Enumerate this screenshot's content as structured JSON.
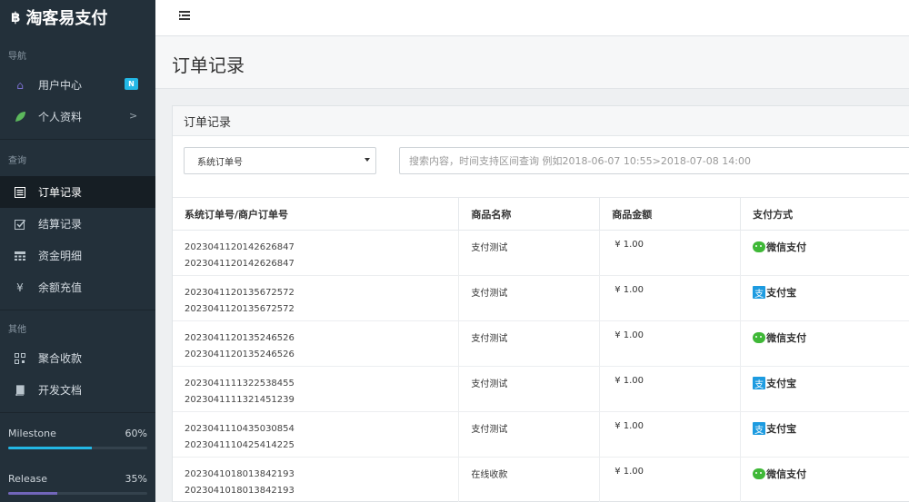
{
  "brand": {
    "icon": "฿",
    "title": "淘客易支付"
  },
  "sidebar": {
    "nav_title": "导航",
    "nav_items": [
      {
        "label": "用户中心",
        "icon": "home-icon",
        "badge": "N"
      },
      {
        "label": "个人资料",
        "icon": "leaf-icon",
        "chevron": ">"
      }
    ],
    "query_title": "查询",
    "query_items": [
      {
        "label": "订单记录",
        "icon": "list-icon",
        "active": true
      },
      {
        "label": "结算记录",
        "icon": "check-square-icon"
      },
      {
        "label": "资金明细",
        "icon": "calculator-icon"
      },
      {
        "label": "余额充值",
        "icon": "yen-icon"
      }
    ],
    "other_title": "其他",
    "other_items": [
      {
        "label": "聚合收款",
        "icon": "qrcode-icon"
      },
      {
        "label": "开发文档",
        "icon": "book-icon"
      }
    ],
    "progress": [
      {
        "label": "Milestone",
        "percent_text": "60%",
        "value": 0.6,
        "color": "#23b7e5"
      },
      {
        "label": "Release",
        "percent_text": "35%",
        "value": 0.35,
        "color": "#7266ba"
      }
    ]
  },
  "header": {
    "menu_icon": "menu-toggle-icon"
  },
  "page": {
    "title": "订单记录"
  },
  "panel": {
    "title": "订单记录",
    "select_value": "系统订单号",
    "search_placeholder": "搜索内容，时间支持区间查询 例如2018-06-07 10:55>2018-07-08 14:00"
  },
  "table": {
    "headers": [
      "系统订单号/商户订单号",
      "商品名称",
      "商品金额",
      "支付方式"
    ],
    "rows": [
      {
        "sys_no": "2023041120142626847",
        "mch_no": "2023041120142626847",
        "name": "支付测试",
        "amount": "¥ 1.00",
        "pay": "微信支付",
        "pay_type": "wechat"
      },
      {
        "sys_no": "2023041120135672572",
        "mch_no": "2023041120135672572",
        "name": "支付测试",
        "amount": "¥ 1.00",
        "pay": "支付宝",
        "pay_type": "alipay"
      },
      {
        "sys_no": "2023041120135246526",
        "mch_no": "2023041120135246526",
        "name": "支付测试",
        "amount": "¥ 1.00",
        "pay": "微信支付",
        "pay_type": "wechat"
      },
      {
        "sys_no": "2023041111322538455",
        "mch_no": "2023041111321451239",
        "name": "支付测试",
        "amount": "¥ 1.00",
        "pay": "支付宝",
        "pay_type": "alipay"
      },
      {
        "sys_no": "2023041110435030854",
        "mch_no": "2023041110425414225",
        "name": "支付测试",
        "amount": "¥ 1.00",
        "pay": "支付宝",
        "pay_type": "alipay"
      },
      {
        "sys_no": "2023041018013842193",
        "mch_no": "2023041018013842193",
        "name": "在线收款",
        "amount": "¥ 1.00",
        "pay": "微信支付",
        "pay_type": "wechat"
      }
    ]
  },
  "icons": {
    "alipay_glyph": "支"
  }
}
